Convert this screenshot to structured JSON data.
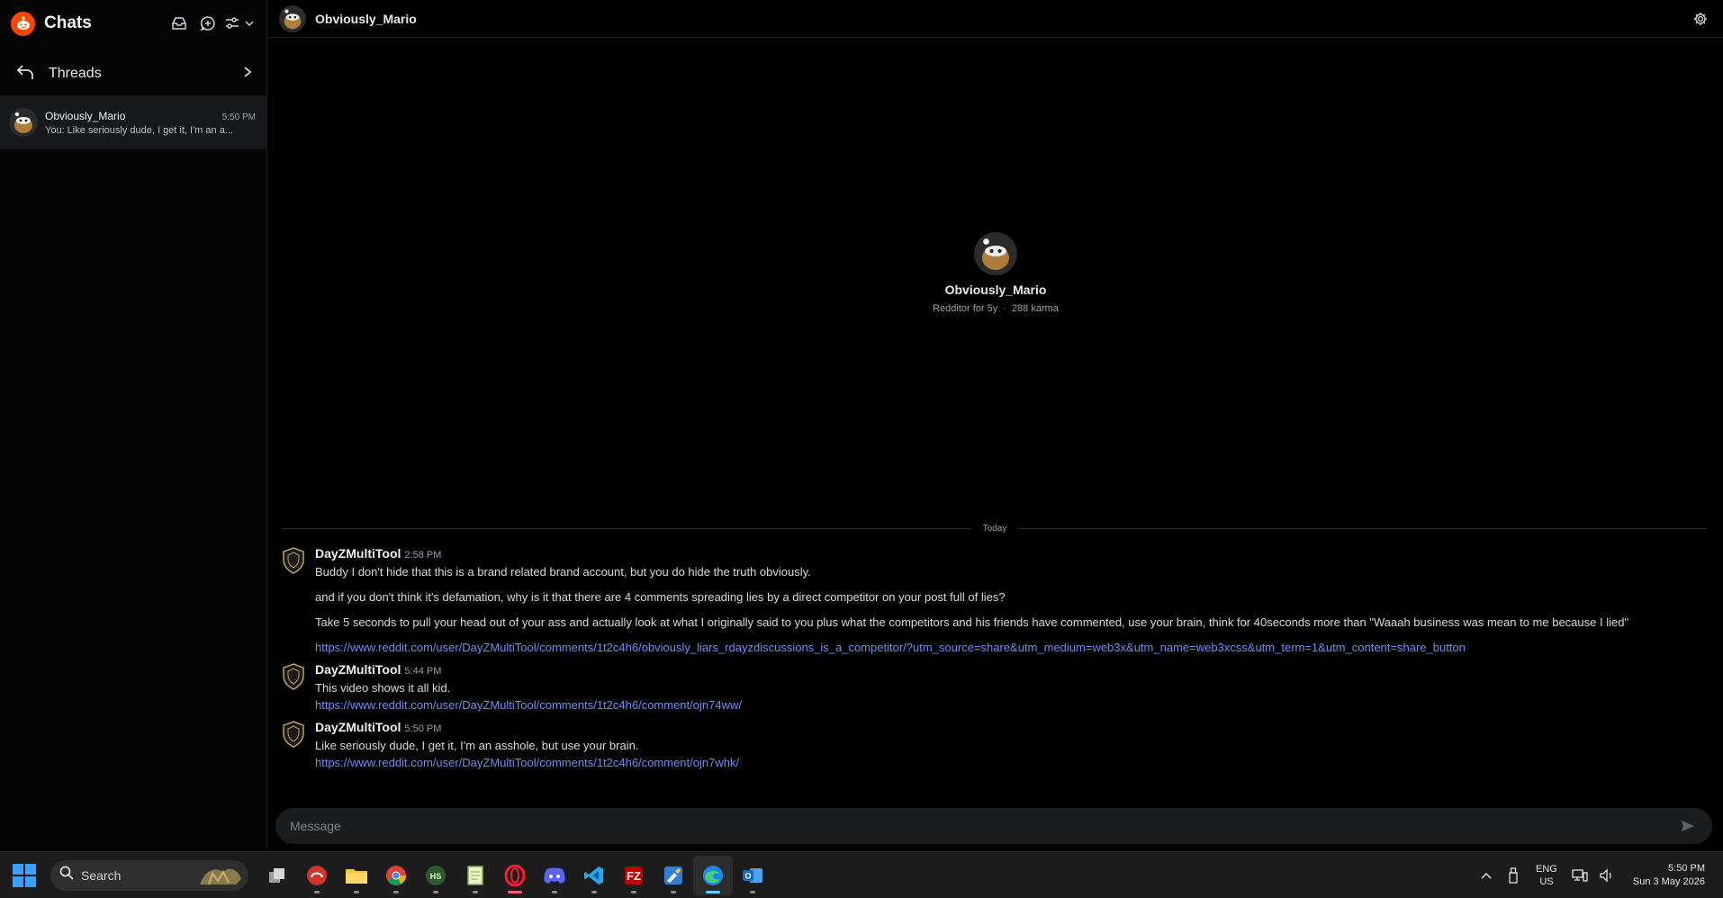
{
  "app": {
    "title": "Chats"
  },
  "sidebar": {
    "threads_label": "Threads",
    "chats": [
      {
        "name": "Obviously_Mario",
        "time": "5:50 PM",
        "preview": "You: Like seriously dude, I get it, I'm an a..."
      }
    ]
  },
  "conversation": {
    "header_name": "Obviously_Mario",
    "profile": {
      "name": "Obviously_Mario",
      "age": "Redditor for 5y",
      "separator": "·",
      "karma": "288 karma"
    },
    "divider": "Today",
    "messages": [
      {
        "author": "DayZMultiTool",
        "time": "2:58 PM",
        "lines": [
          "Buddy I don't hide that this is a brand related brand account, but you do hide the truth obviously.",
          "and if you don't think it's defamation, why is it that there are 4 comments spreading lies by a direct competitor on your post full of lies?",
          "Take 5 seconds to pull your head out of your ass and actually look at what I originally said to you plus what the competitors and his friends have commented, use your brain, think for 40seconds more than \"Waaah business was mean to me because I lied\""
        ],
        "link": "https://www.reddit.com/user/DayZMultiTool/comments/1t2c4h6/obviously_liars_rdayzdiscussions_is_a_competitor/?utm_source=share&utm_medium=web3x&utm_name=web3xcss&utm_term=1&utm_content=share_button"
      },
      {
        "author": "DayZMultiTool",
        "time": "5:44 PM",
        "lines": [
          "This video shows it all kid."
        ],
        "link": "https://www.reddit.com/user/DayZMultiTool/comments/1t2c4h6/comment/ojn74ww/"
      },
      {
        "author": "DayZMultiTool",
        "time": "5:50 PM",
        "lines": [
          "Like seriously dude, I get it, I'm an asshole, but use your brain."
        ],
        "link": "https://www.reddit.com/user/DayZMultiTool/comments/1t2c4h6/comment/ojn7whk/"
      }
    ],
    "composer": {
      "placeholder": "Message"
    }
  },
  "taskbar": {
    "search_label": "Search",
    "apps": [
      "Task View",
      "Teamspeak",
      "File Explorer",
      "Chrome",
      "HS",
      "Notepad++",
      "Opera",
      "Discord",
      "VS Code",
      "FileZilla",
      "Paint",
      "Edge",
      "Outlook"
    ],
    "lang_top": "ENG",
    "lang_bottom": "US",
    "time": "5:50 PM",
    "date": "Sun 3 May 2026"
  },
  "colors": {
    "accent": "#ff4500",
    "link": "#6d8ff5",
    "active_indicator": "#60cdff"
  },
  "icons": {
    "logo": "reddit-logo-icon",
    "header": [
      "mark-read-icon",
      "new-chat-icon",
      "filter-icon",
      "chevron-down-icon"
    ],
    "threads": [
      "back-arrow-icon",
      "chevron-right-icon"
    ],
    "settings": "gear-icon",
    "send": "send-icon"
  }
}
